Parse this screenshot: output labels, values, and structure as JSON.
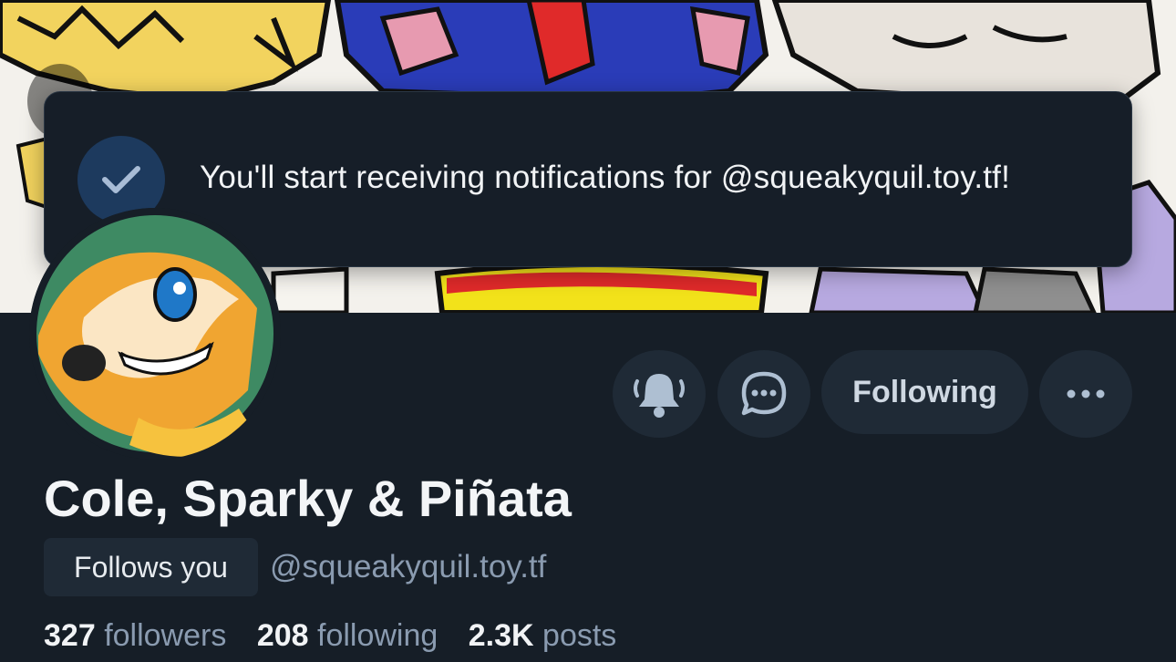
{
  "toast": {
    "message": "You'll start receiving notifications for @squeakyquil.toy.tf!",
    "icon": "check-icon"
  },
  "header": {
    "back_icon": "back-arrow-icon"
  },
  "profile": {
    "display_name": "Cole, Sparky & Piñata",
    "follows_you_label": "Follows you",
    "handle": "@squeakyquil.toy.tf",
    "stats": {
      "followers_count": "327",
      "followers_label": "followers",
      "following_count": "208",
      "following_label": "following",
      "posts_count": "2.3K",
      "posts_label": "posts"
    }
  },
  "actions": {
    "bell_icon": "bell-ringing-icon",
    "message_icon": "chat-bubble-icon",
    "following_label": "Following",
    "more_icon": "ellipsis-icon"
  },
  "colors": {
    "background": "#161e27",
    "button_bg": "#1f2a36",
    "muted_text": "#8a9bb0",
    "accent_check_bg": "#1d3a5e"
  }
}
